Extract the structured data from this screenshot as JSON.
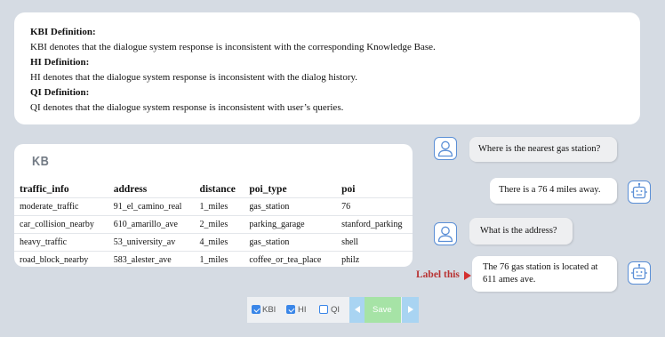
{
  "definitions": {
    "kbi_heading": "KBI Definition:",
    "kbi_text": "KBI denotes that the dialogue system response is inconsistent with the corresponding Knowledge Base.",
    "hi_heading": "HI Definition:",
    "hi_text": "HI denotes that the dialogue system response is inconsistent with the dialog history.",
    "qi_heading": "QI Definition:",
    "qi_text": "QI denotes that the dialogue system response is inconsistent with user’s queries."
  },
  "kb": {
    "title": "KB",
    "columns": [
      "traffic_info",
      "address",
      "distance",
      "poi_type",
      "poi"
    ],
    "rows": [
      [
        "moderate_traffic",
        "91_el_camino_real",
        "1_miles",
        "gas_station",
        "76"
      ],
      [
        "car_collision_nearby",
        "610_amarillo_ave",
        "2_miles",
        "parking_garage",
        "stanford_parking"
      ],
      [
        "heavy_traffic",
        "53_university_av",
        "4_miles",
        "gas_station",
        "shell"
      ],
      [
        "road_block_nearby",
        "583_alester_ave",
        "1_miles",
        "coffee_or_tea_place",
        "philz"
      ]
    ]
  },
  "dialog": {
    "user1": "Where is the nearest gas station?",
    "sys1": "There is a 76 4 miles away.",
    "user2": "What is the address?",
    "sys2_line1": "The 76 gas station is located at",
    "sys2_line2": "611 ames ave.",
    "label_this": "Label this"
  },
  "toolbar": {
    "kbi_label": "KBI",
    "kbi_checked": true,
    "hi_label": "HI",
    "hi_checked": true,
    "qi_label": "QI",
    "qi_checked": false,
    "save_label": "Save"
  },
  "icons": {
    "user_avatar": "person-icon",
    "system_avatar": "robot-icon",
    "pointer": "triangle-right-icon",
    "prev": "triangle-left-icon",
    "next": "triangle-right-icon"
  },
  "colors": {
    "background": "#d5dbe3",
    "accent_blue": "#3a86e8",
    "label_red": "#b83232",
    "save_green": "#a6e3a6",
    "nav_blue": "#a9d4f2"
  }
}
